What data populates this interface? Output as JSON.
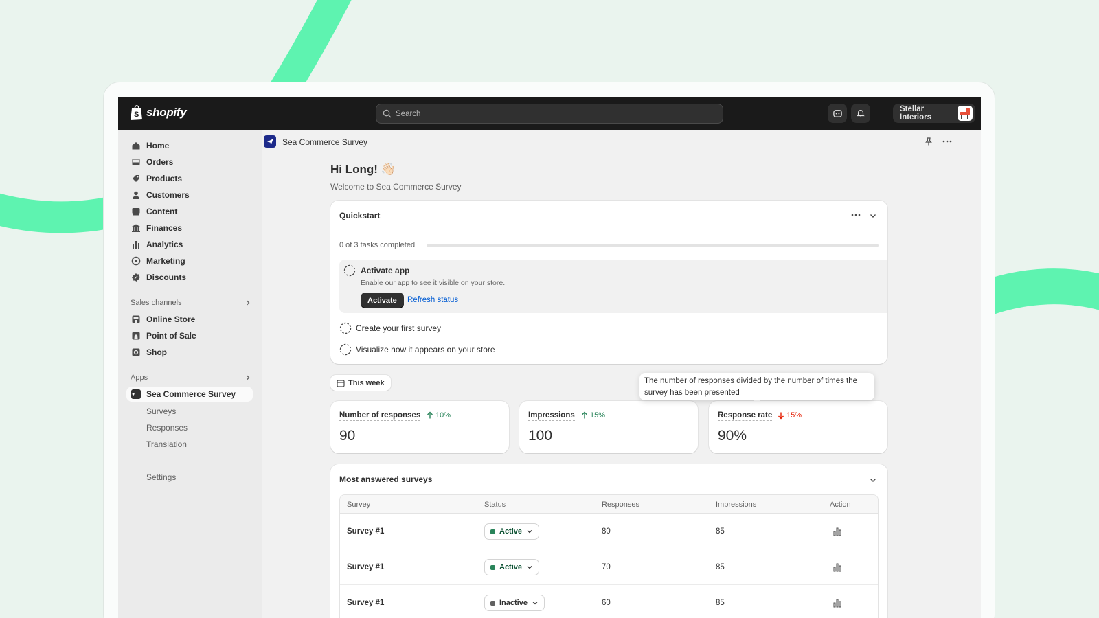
{
  "colors": {
    "brand_green": "#5ef3b0",
    "topbar": "#1a1a1a",
    "accent_link": "#005bd3",
    "active_status": "#29845a",
    "inactive_status": "#616161",
    "trend_up": "#29845a",
    "trend_down": "#e51c00"
  },
  "topbar": {
    "logo_text": "shopify",
    "search_placeholder": "Search",
    "store_name": "Stellar Interiors",
    "icons": [
      "assistant-icon",
      "bell-icon"
    ]
  },
  "sidebar": {
    "items": [
      {
        "label": "Home",
        "icon": "home-icon"
      },
      {
        "label": "Orders",
        "icon": "inbox-icon"
      },
      {
        "label": "Products",
        "icon": "tag-icon"
      },
      {
        "label": "Customers",
        "icon": "person-icon"
      },
      {
        "label": "Content",
        "icon": "content-icon"
      },
      {
        "label": "Finances",
        "icon": "bank-icon"
      },
      {
        "label": "Analytics",
        "icon": "bar-chart-icon"
      },
      {
        "label": "Marketing",
        "icon": "target-icon"
      },
      {
        "label": "Discounts",
        "icon": "discount-icon"
      }
    ],
    "sales_channels_label": "Sales channels",
    "sales_channels": [
      {
        "label": "Online Store",
        "icon": "store-icon"
      },
      {
        "label": "Point of Sale",
        "icon": "pos-icon"
      },
      {
        "label": "Shop",
        "icon": "shop-icon"
      }
    ],
    "apps_label": "Apps",
    "app": {
      "label": "Sea Commerce Survey"
    },
    "app_subitems": [
      "Surveys",
      "Responses",
      "Translation"
    ],
    "settings_label": "Settings"
  },
  "main": {
    "app_title": "Sea Commerce Survey",
    "greeting": "Hi Long! 👋🏻",
    "welcome": "Welcome to Sea Commerce Survey",
    "quickstart": {
      "title": "Quickstart",
      "progress_label": "0 of 3 tasks completed",
      "progress_fraction": 0,
      "active_task": {
        "title": "Activate app",
        "description": "Enable our app to see it visible on your store.",
        "button": "Activate",
        "link": "Refresh status"
      },
      "tasks": [
        "Create your first survey",
        "Visualize how it appears on your store"
      ]
    },
    "date_filter": "This week",
    "tooltip": "The number of responses divided by the number of times the survey has been presented",
    "stats": [
      {
        "label": "Number of responses",
        "trend": "10%",
        "direction": "up",
        "value": "90"
      },
      {
        "label": "Impressions",
        "trend": "15%",
        "direction": "up",
        "value": "100"
      },
      {
        "label": "Response rate",
        "trend": "15%",
        "direction": "down",
        "value": "90%"
      }
    ],
    "most_answered": {
      "title": "Most answered surveys",
      "columns": [
        "Survey",
        "Status",
        "Responses",
        "Impressions",
        "Action"
      ],
      "rows": [
        {
          "survey": "Survey #1",
          "status": "Active",
          "responses": "80",
          "impressions": "85"
        },
        {
          "survey": "Survey #1",
          "status": "Active",
          "responses": "70",
          "impressions": "85"
        },
        {
          "survey": "Survey #1",
          "status": "Inactive",
          "responses": "60",
          "impressions": "85"
        }
      ]
    }
  }
}
